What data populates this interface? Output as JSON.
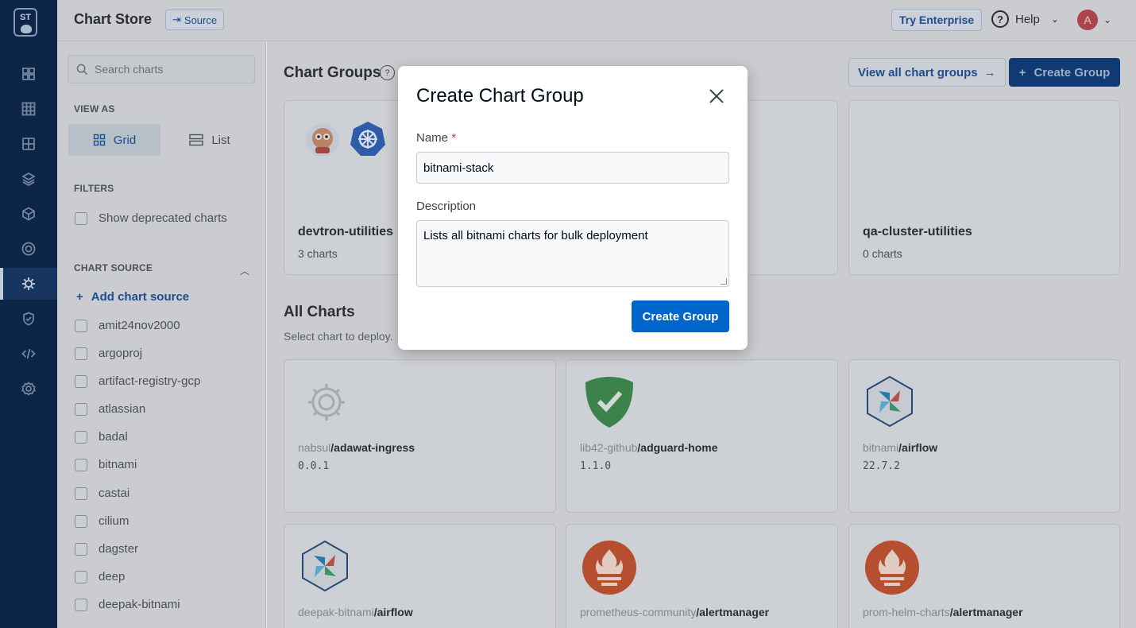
{
  "rail": {
    "logo": "ST",
    "items": [
      {
        "icon": "dashboard-icon"
      },
      {
        "icon": "grid-icon"
      },
      {
        "icon": "apps-icon"
      },
      {
        "icon": "stack-icon"
      },
      {
        "icon": "cube-icon"
      },
      {
        "icon": "target-icon"
      },
      {
        "icon": "chart-store-icon",
        "active": true
      },
      {
        "icon": "shield-icon"
      },
      {
        "icon": "code-icon"
      },
      {
        "icon": "settings-icon"
      }
    ]
  },
  "header": {
    "title": "Chart Store",
    "source_label": "Source",
    "enterprise_label": "Try Enterprise",
    "help_label": "Help",
    "avatar_initial": "A"
  },
  "sidebar": {
    "search_placeholder": "Search charts",
    "view_as_label": "VIEW AS",
    "grid_label": "Grid",
    "list_label": "List",
    "filters_label": "FILTERS",
    "deprecated_label": "Show deprecated charts",
    "chart_source_label": "CHART SOURCE",
    "add_source_label": "Add chart source",
    "sources": [
      "amit24nov2000",
      "argoproj",
      "artifact-registry-gcp",
      "atlassian",
      "badal",
      "bitnami",
      "castai",
      "cilium",
      "dagster",
      "deep",
      "deepak-bitnami"
    ]
  },
  "main": {
    "chart_groups_title": "Chart Groups",
    "view_all_label": "View all chart groups",
    "create_group_label": "Create Group",
    "groups": [
      {
        "name": "devtron-utilities",
        "count": "3 charts"
      },
      {
        "name": "qa-cluster-utilities",
        "count": "0 charts"
      }
    ],
    "all_charts_title": "All Charts",
    "all_charts_sub": "Select chart to deploy.",
    "charts": [
      {
        "source": "nabsul",
        "name": "/adawat-ingress",
        "version": "0.0.1"
      },
      {
        "source": "lib42-github",
        "name": "/adguard-home",
        "version": "1.1.0"
      },
      {
        "source": "bitnami",
        "name": "/airflow",
        "version": "22.7.2"
      },
      {
        "source": "deepak-bitnami",
        "name": "/airflow",
        "version": ""
      },
      {
        "source": "prometheus-community",
        "name": "/alertmanager",
        "version": ""
      },
      {
        "source": "prom-helm-charts",
        "name": "/alertmanager",
        "version": ""
      }
    ]
  },
  "modal": {
    "title": "Create Chart Group",
    "name_label": "Name",
    "required_mark": "*",
    "name_value": "bitnami-stack",
    "description_label": "Description",
    "description_value": "Lists all bitnami charts for bulk deployment",
    "submit_label": "Create Group"
  },
  "colors": {
    "primary": "#0066cc",
    "nav_bg": "#0b2447",
    "required": "#e0382f"
  }
}
